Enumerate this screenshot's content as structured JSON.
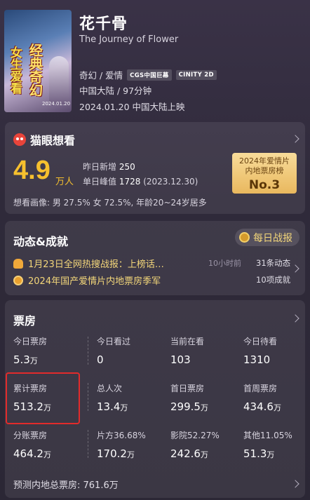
{
  "movie": {
    "title": "花千骨",
    "subtitle": "The Journey of Flower",
    "genre": "奇幻 / 爱情",
    "tags": [
      "CGS中国巨幕",
      "CINITY 2D"
    ],
    "region_duration": "中国大陆 / 97分钟",
    "release": "2024.01.20 中国大陆上映",
    "poster": {
      "text1": "女生爱看",
      "text2": "经典奇幻",
      "date": "2024.01.20"
    }
  },
  "want": {
    "section_title": "猫眼想看",
    "count": "4.9",
    "unit": "万人",
    "yesterday_label": "昨日新增",
    "yesterday_value": "250",
    "peak_label": "单日峰值",
    "peak_value": "1728",
    "peak_date": "(2023.12.30)",
    "rank_line1": "2024年爱情片",
    "rank_line2": "内地票房榜",
    "rank_value": "No.3",
    "demographics": "想看画像: 男 27.5%  女 72.5%, 年龄20~24岁居多"
  },
  "news": {
    "section_title": "动态&成就",
    "daily_report": "每日战报",
    "items": [
      {
        "text": "1月23日全网热搜战报：上榜话…",
        "time": "10小时前",
        "count": "31条动态"
      },
      {
        "text": "2024年国产爱情片内地票房季军",
        "time": "",
        "count": "10项成就"
      }
    ]
  },
  "boxoffice": {
    "section_title": "票房",
    "cells": [
      {
        "label": "今日票房",
        "value": "5.3",
        "unit": "万"
      },
      {
        "label": "今日看过",
        "value": "0",
        "unit": ""
      },
      {
        "label": "当前在看",
        "value": "103",
        "unit": ""
      },
      {
        "label": "今日待看",
        "value": "1310",
        "unit": ""
      },
      {
        "label": "累计票房",
        "value": "513.2",
        "unit": "万"
      },
      {
        "label": "总人次",
        "value": "13.4",
        "unit": "万"
      },
      {
        "label": "首日票房",
        "value": "299.5",
        "unit": "万"
      },
      {
        "label": "首周票房",
        "value": "434.6",
        "unit": "万"
      },
      {
        "label": "分账票房",
        "value": "464.2",
        "unit": "万"
      },
      {
        "label": "片方36.68%",
        "value": "170.2",
        "unit": "万"
      },
      {
        "label": "影院52.27%",
        "value": "242.6",
        "unit": "万"
      },
      {
        "label": "其他11.05%",
        "value": "51.3",
        "unit": "万"
      }
    ],
    "forecast": "预测内地总票房: 761.6万"
  },
  "colors": {
    "accent_gold": "#f6c02e",
    "highlight_red": "#e22b2b",
    "background": "#2f2a3a"
  }
}
